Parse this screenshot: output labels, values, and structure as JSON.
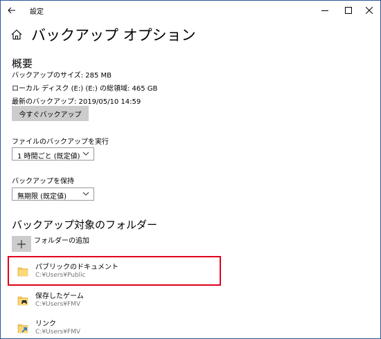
{
  "window": {
    "title": "設定",
    "back_icon": "arrow-left-icon",
    "controls": [
      "minimize-icon",
      "maximize-icon",
      "close-icon"
    ]
  },
  "header": {
    "icon": "home-icon",
    "title": "バックアップ オプション"
  },
  "overview": {
    "heading": "概要",
    "size_line": "バックアップのサイズ: 285 MB",
    "disk_line": "ローカル ディスク (E:) (E:) の総領域: 465 GB",
    "latest_line": "最新のバックアップ: 2019/05/10 14:59",
    "backup_now_label": "今すぐバックアップ"
  },
  "schedule": {
    "label": "ファイルのバックアップを実行",
    "value": "1 時間ごと (既定値)"
  },
  "retention": {
    "label": "バックアップを保持",
    "value": "無期限 (既定値)"
  },
  "folders": {
    "heading": "バックアップ対象のフォルダー",
    "add_label": "フォルダーの追加",
    "items": [
      {
        "name": "パブリックのドキュメント",
        "path": "C:¥Users¥Public",
        "icon": "folder-icon"
      },
      {
        "name": "保存したゲーム",
        "path": "C:¥Users¥FMV",
        "icon": "saved-games-folder-icon"
      },
      {
        "name": "リンク",
        "path": "C:¥Users¥FMV",
        "icon": "links-folder-icon"
      }
    ]
  },
  "colors": {
    "button_gray": "#cccccc",
    "highlight_red": "#e0001a",
    "folder_yellow": "#f2c65b",
    "path_gray": "#767676"
  }
}
